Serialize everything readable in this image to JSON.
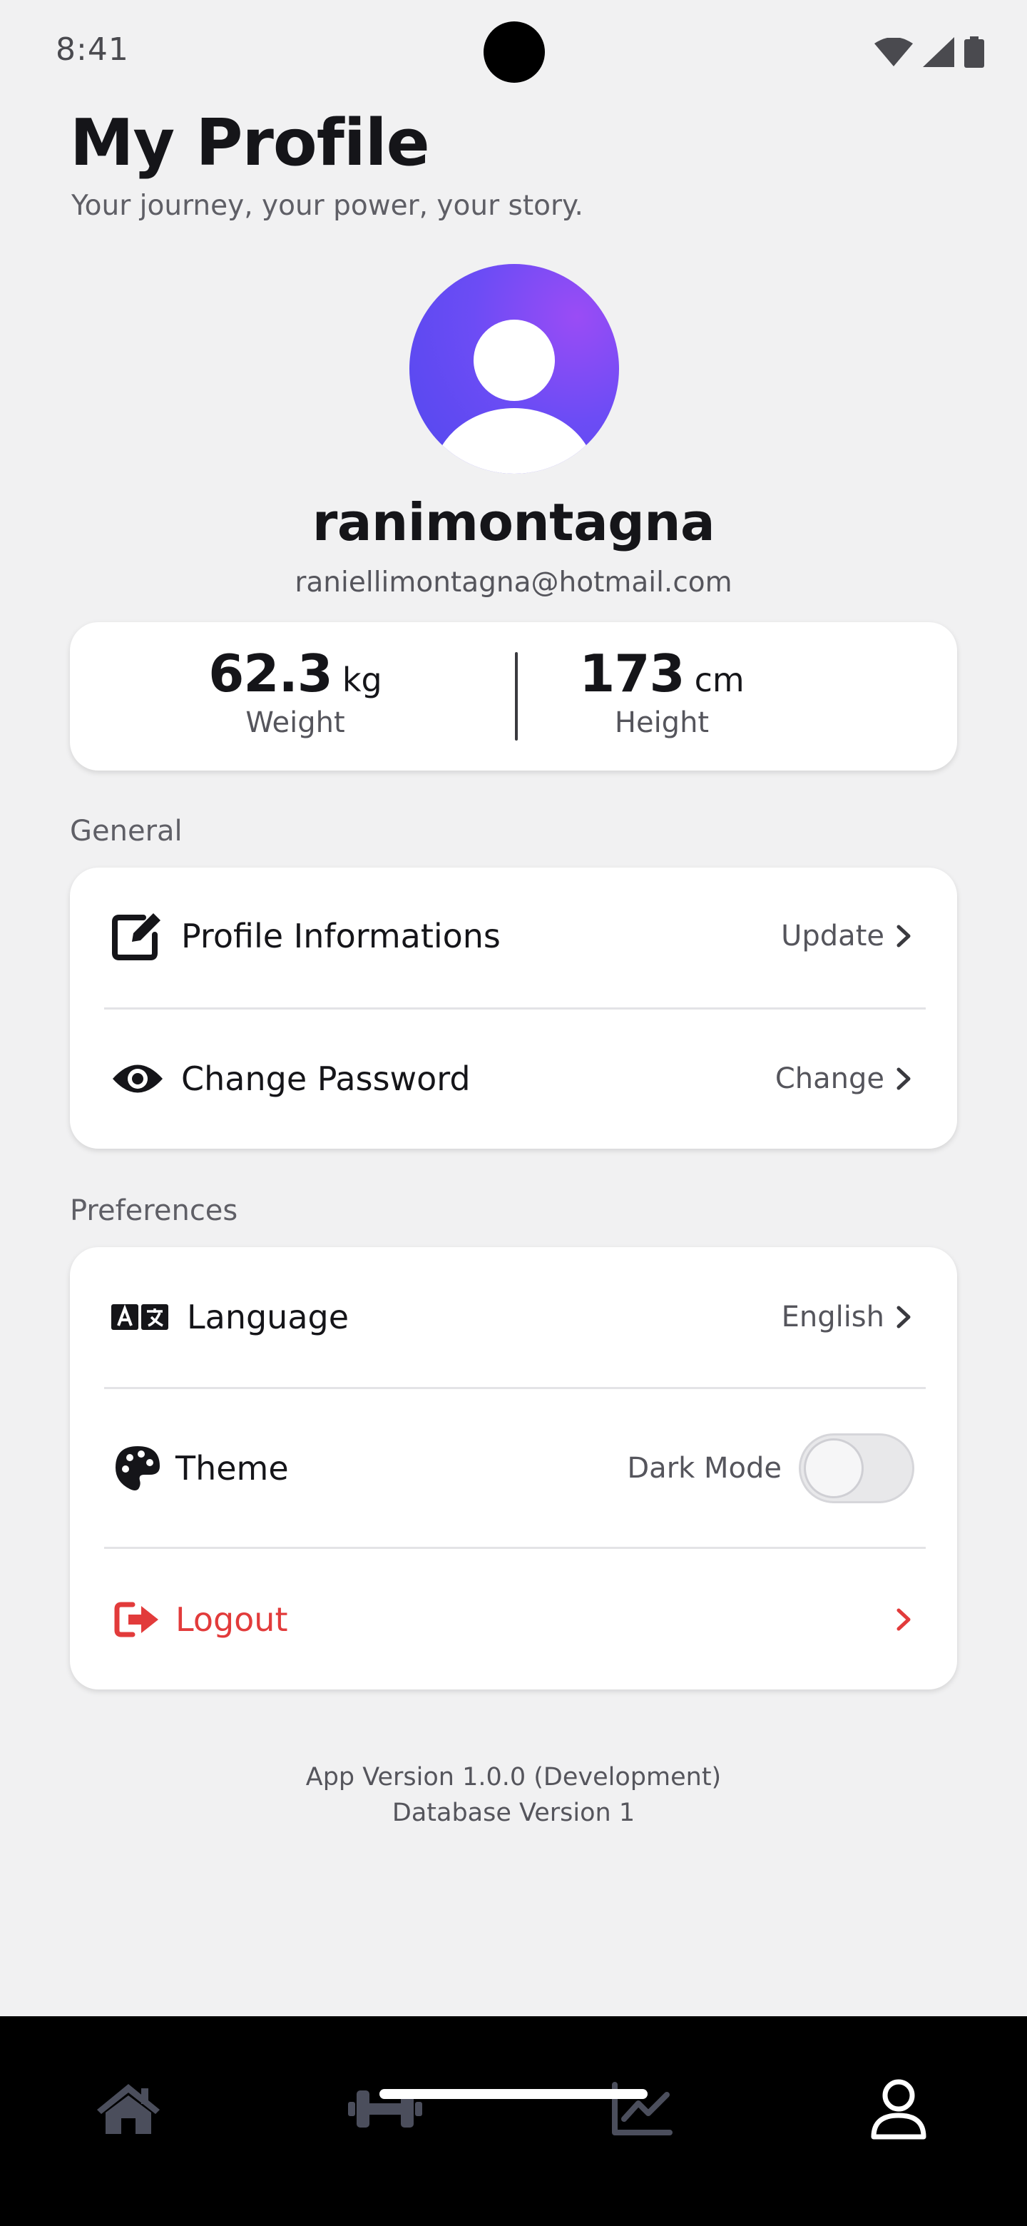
{
  "status_bar": {
    "time": "8:41"
  },
  "header": {
    "title": "My Profile",
    "subtitle": "Your journey, your power, your story."
  },
  "profile": {
    "username": "ranimontagna",
    "email": "raniellimontagna@hotmail.com"
  },
  "stats": {
    "weight": {
      "value": "62.3",
      "unit": "kg",
      "label": "Weight"
    },
    "height": {
      "value": "173",
      "unit": "cm",
      "label": "Height"
    }
  },
  "general": {
    "section_label": "General",
    "items": [
      {
        "icon": "edit-icon",
        "label": "Profile Informations",
        "value": "Update"
      },
      {
        "icon": "eye-icon",
        "label": "Change Password",
        "value": "Change"
      }
    ]
  },
  "preferences": {
    "section_label": "Preferences",
    "language": {
      "icon": "translate-icon",
      "label": "Language",
      "value": "English"
    },
    "theme": {
      "icon": "palette-icon",
      "label": "Theme",
      "value": "Dark Mode",
      "dark_mode_enabled": false
    },
    "logout": {
      "icon": "logout-icon",
      "label": "Logout"
    }
  },
  "footer": {
    "app_version": "App Version 1.0.0 (Development)",
    "db_version": "Database Version 1"
  },
  "bottom_nav": {
    "items": [
      {
        "icon": "home-icon",
        "active": false
      },
      {
        "icon": "dumbbell-icon",
        "active": false
      },
      {
        "icon": "chart-line-icon",
        "active": false
      },
      {
        "icon": "user-icon",
        "active": true
      }
    ]
  },
  "colors": {
    "background": "#f1f1f2",
    "card": "#ffffff",
    "danger": "#e23b3b",
    "avatar_gradient_start": "#5148ee",
    "avatar_gradient_end": "#9a4cf5",
    "nav_inactive": "#4b4e5c",
    "nav_active": "#ffffff"
  }
}
